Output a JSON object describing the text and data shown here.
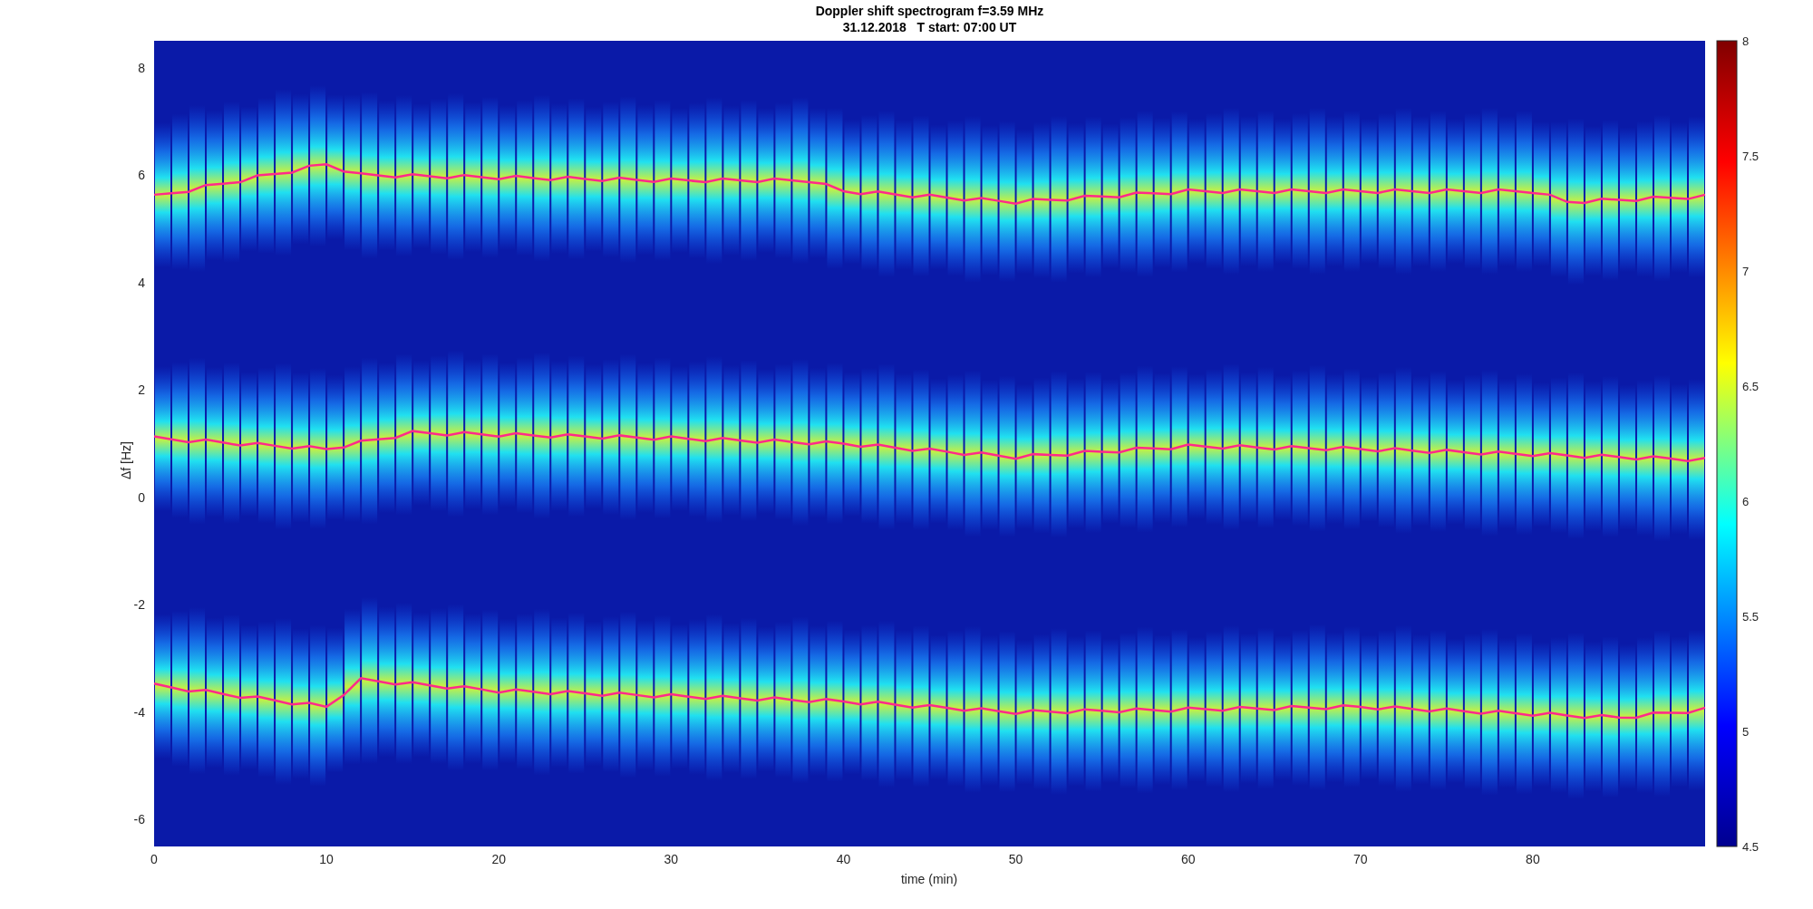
{
  "figure": {
    "title_lines": [
      "Doppler shift spectrogram f=3.59 MHz",
      "31.12.2018   T start: 07:00 UT"
    ],
    "ylabel": "Δf [Hz]",
    "xlabel": "time (min)",
    "yticks": [
      "8",
      "6",
      "4",
      "2",
      "0",
      "-2",
      "-4",
      "-6"
    ],
    "xticks": [
      "0",
      "10",
      "20",
      "30",
      "40",
      "50",
      "60",
      "70",
      "80"
    ],
    "colorbar_ticks": [
      "8",
      "7.5",
      "7",
      "6.5",
      "6",
      "5.5",
      "5",
      "4.5"
    ]
  }
}
